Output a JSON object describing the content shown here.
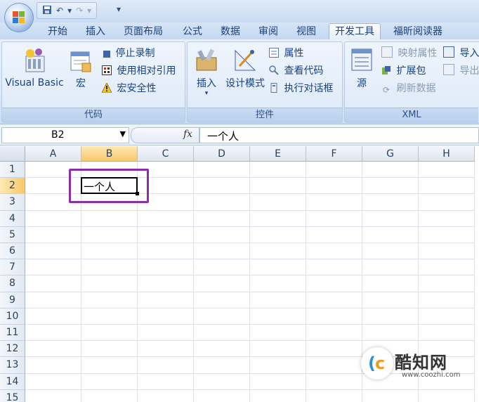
{
  "qat": {
    "save_icon": "save-icon",
    "undo_icon": "undo-icon",
    "redo_icon": "redo-icon",
    "more": "▾"
  },
  "tabs": [
    {
      "label": "开始"
    },
    {
      "label": "插入"
    },
    {
      "label": "页面布局"
    },
    {
      "label": "公式"
    },
    {
      "label": "数据"
    },
    {
      "label": "审阅"
    },
    {
      "label": "视图"
    },
    {
      "label": "开发工具"
    },
    {
      "label": "福昕阅读器"
    }
  ],
  "ribbon": {
    "code": {
      "label": "代码",
      "visual_basic": "Visual Basic",
      "macro": "宏",
      "stop_recording": "停止录制",
      "relative_ref": "使用相对引用",
      "macro_security": "宏安全性"
    },
    "controls": {
      "label": "控件",
      "insert": "插入",
      "design_mode": "设计模式",
      "properties": "属性",
      "view_code": "查看代码",
      "run_dialog": "执行对话框"
    },
    "xml": {
      "label": "XML",
      "source": "源",
      "map_properties": "映射属性",
      "expansion_pack": "扩展包",
      "refresh_data": "刷新数据",
      "import": "导入",
      "export": "导出"
    }
  },
  "formula_bar": {
    "name_box": "B2",
    "fx": "fx",
    "value": "一个人"
  },
  "grid": {
    "columns": [
      "A",
      "B",
      "C",
      "D",
      "E",
      "F",
      "G",
      "H"
    ],
    "rows": [
      "1",
      "2",
      "3",
      "4",
      "5",
      "6",
      "7",
      "8",
      "9",
      "10",
      "11",
      "12",
      "13",
      "14",
      "15"
    ],
    "active_cell_text": "一个人"
  },
  "watermark": {
    "brand": "酷知网",
    "url": "www.coozhi.com"
  },
  "colors": {
    "accent": "#8a2fa8",
    "selected_header": "#f8c86c",
    "ribbon": "#dbe8f8"
  }
}
